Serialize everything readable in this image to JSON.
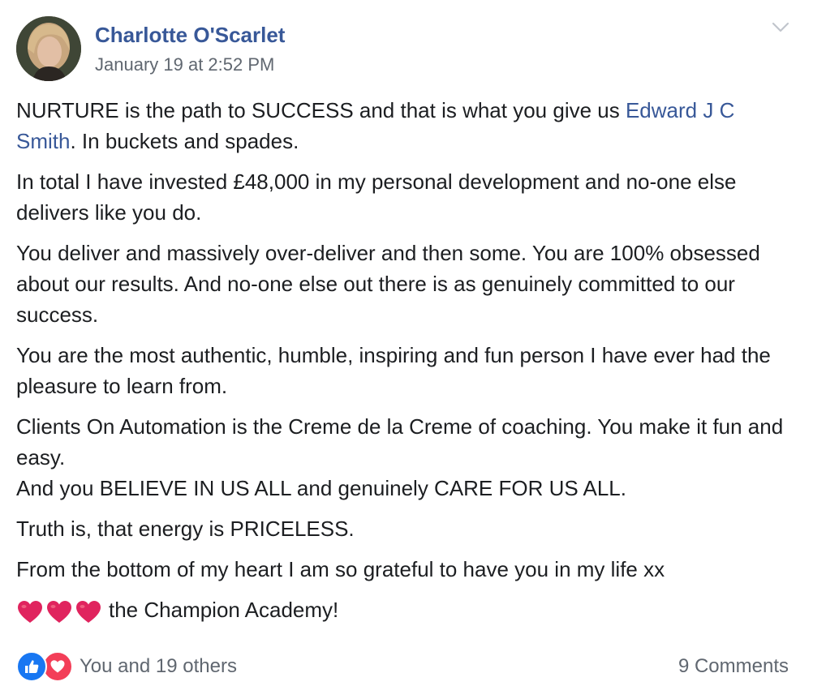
{
  "post": {
    "author": "Charlotte O'Scarlet",
    "timestamp": "January 19 at 2:52 PM",
    "paragraphs": {
      "p1_before": "NURTURE is the path to SUCCESS and that is what you give us ",
      "p1_mention": "Edward J C Smith",
      "p1_after": ". In buckets and spades.",
      "p2": "In total I have invested £48,000 in my personal development and no-one else delivers like you do.",
      "p3": "You deliver and massively over-deliver and then some. You are 100% obsessed about our results. And no-one else out there is as genuinely committed to our success.",
      "p4": "You are the most authentic, humble, inspiring and fun person I have ever had the pleasure to learn from.",
      "p5_line1": "Clients On Automation is the Creme de la Creme of coaching. You make it fun and easy.",
      "p5_line2": "And you BELIEVE IN US ALL and genuinely CARE FOR US ALL.",
      "p6": "Truth is, that energy is PRICELESS.",
      "p7": "From the bottom of my heart I am so grateful to have you in my life xx",
      "p8": "the Champion Academy!"
    },
    "emoji_icons": [
      "heart-icon",
      "heart-icon",
      "heart-icon"
    ],
    "colors": {
      "link": "#385898",
      "meta": "#606770",
      "text": "#1c1e21",
      "like": "#1877f2",
      "love": "#f33e58",
      "heart_emoji": "#e0245e"
    }
  },
  "footer": {
    "reaction_icons": [
      "like-icon",
      "love-icon"
    ],
    "reaction_summary": "You and 19 others",
    "comments": "9 Comments"
  }
}
